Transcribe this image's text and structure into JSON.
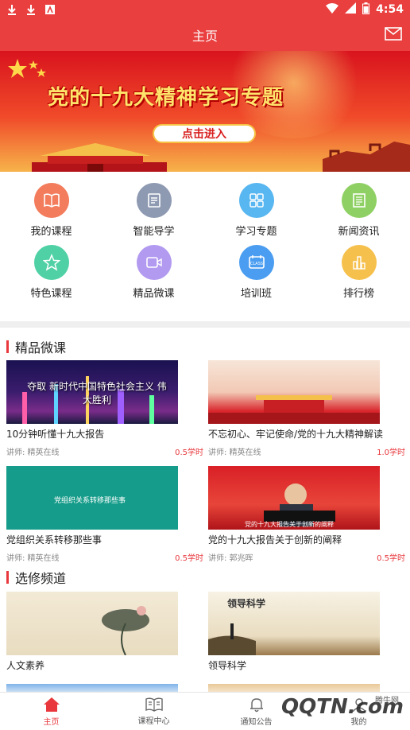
{
  "status_bar": {
    "time": "4:54"
  },
  "header": {
    "title": "主页"
  },
  "banner": {
    "title": "党的十九大精神学习专题",
    "button_label": "点击进入"
  },
  "grid_items": [
    {
      "label": "我的课程",
      "color": "#f37c5c"
    },
    {
      "label": "智能导学",
      "color": "#8e9ab2"
    },
    {
      "label": "学习专题",
      "color": "#58b6f0"
    },
    {
      "label": "新闻资讯",
      "color": "#8fd064"
    },
    {
      "label": "特色课程",
      "color": "#4fd1a5"
    },
    {
      "label": "精品微课",
      "color": "#b29af0"
    },
    {
      "label": "培训班",
      "color": "#4a9df0"
    },
    {
      "label": "排行榜",
      "color": "#f6c04c"
    }
  ],
  "sections": {
    "weike": {
      "title": "精品微课",
      "cards": [
        {
          "title": "10分钟听懂十九大报告",
          "lecturer": "讲师: 精英在线",
          "hours": "0.5学时",
          "thumb_text": "夺取 新时代中国特色社会主义 伟大胜利"
        },
        {
          "title": "不忘初心、牢记使命/党的十九大精神解读",
          "lecturer": "讲师: 精英在线",
          "hours": "1.0学时",
          "thumb_text": ""
        },
        {
          "title": "党组织关系转移那些事",
          "lecturer": "讲师: 精英在线",
          "hours": "0.5学时",
          "thumb_text": "党组织关系转移那些事"
        },
        {
          "title": "党的十九大报告关于创新的阐释",
          "lecturer": "讲师: 郭兆晖",
          "hours": "0.5学时",
          "thumb_text": "党的十九大报告关于创新的阐释"
        }
      ]
    },
    "xuanxiu": {
      "title": "选修频道",
      "cards": [
        {
          "title": "人文素养",
          "thumb_text": ""
        },
        {
          "title": "领导科学",
          "thumb_text": "领导科学"
        }
      ]
    }
  },
  "bottom_nav": [
    {
      "label": "主页",
      "active": true
    },
    {
      "label": "课程中心",
      "active": false
    },
    {
      "label": "通知公告",
      "active": false
    },
    {
      "label": "我的",
      "active": false
    }
  ],
  "watermark": {
    "text": "QQTN.com",
    "small": "腾牛网"
  }
}
